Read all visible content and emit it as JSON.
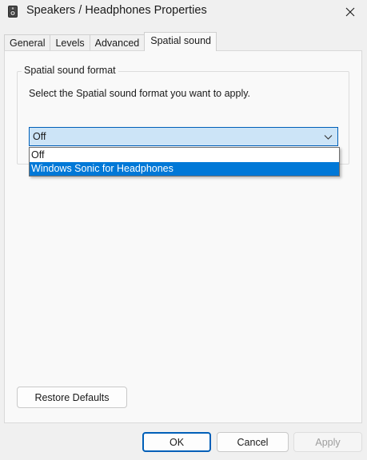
{
  "window": {
    "title": "Speakers / Headphones Properties",
    "icon": "speaker-device-icon",
    "close_icon": "close-icon"
  },
  "tabs": [
    {
      "label": "General",
      "active": false
    },
    {
      "label": "Levels",
      "active": false
    },
    {
      "label": "Advanced",
      "active": false
    },
    {
      "label": "Spatial sound",
      "active": true
    }
  ],
  "spatial": {
    "group_label": "Spatial sound format",
    "instruction": "Select the Spatial sound format you want to apply.",
    "combo_value": "Off",
    "options": [
      {
        "label": "Off",
        "highlighted": false
      },
      {
        "label": "Windows Sonic for Headphones",
        "highlighted": true
      }
    ]
  },
  "buttons": {
    "restore": "Restore Defaults",
    "ok": "OK",
    "cancel": "Cancel",
    "apply": "Apply",
    "apply_enabled": false
  },
  "colors": {
    "accent": "#005fb8",
    "selection": "#0078d7",
    "combo_background": "#cce4f7"
  }
}
